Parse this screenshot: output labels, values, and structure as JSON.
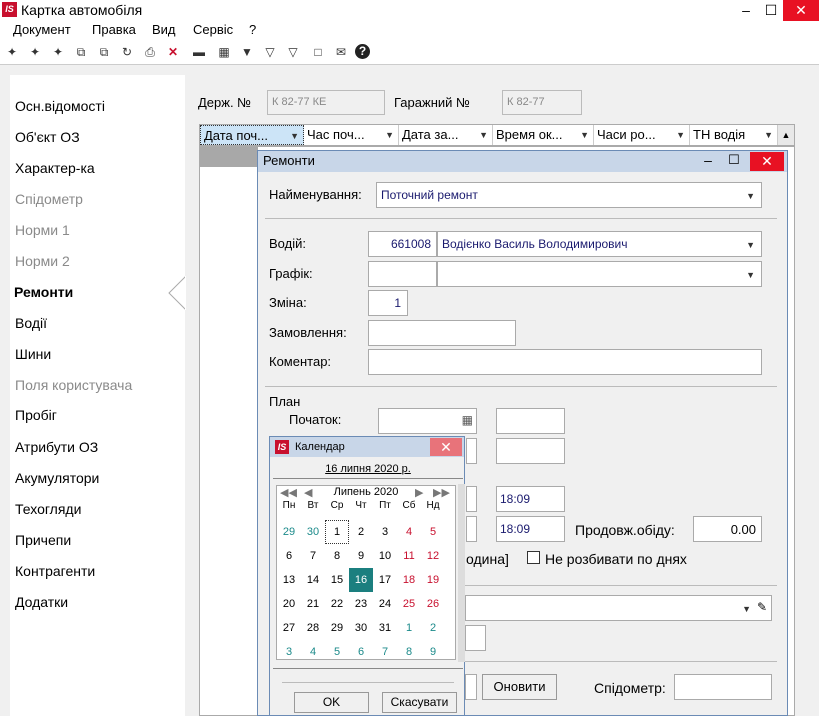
{
  "window": {
    "title": "Картка автомобіля",
    "logo": "IS"
  },
  "menu": [
    "Документ",
    "Правка",
    "Вид",
    "Сервіс",
    "?"
  ],
  "sidebar": [
    "Осн.відомості",
    "Об'єкт ОЗ",
    "Характер-ка",
    "Спідометр",
    "Норми 1",
    "Норми 2",
    "Ремонти",
    "Водії",
    "Шини",
    "Поля користувача",
    "Пробіг",
    "Атрибути ОЗ",
    "Акумулятори",
    "Техогляди",
    "Причепи",
    "Контрагенти",
    "Додатки"
  ],
  "header": {
    "state_no_label": "Держ. №",
    "state_no": "К 82-77 КЕ",
    "garage_no_label": "Гаражний №",
    "garage_no": "К 82-77"
  },
  "grid": {
    "columns": [
      "Дата поч...",
      "Час поч...",
      "Дата за...",
      "Время ок...",
      "Часи ро...",
      "ТН водія"
    ]
  },
  "dialog": {
    "title": "Ремонти",
    "name_label": "Найменування:",
    "name_value": "Поточний ремонт",
    "driver_label": "Водій:",
    "driver_code": "661008",
    "driver_name": "Водієнко Василь Володимирович",
    "schedule_label": "Графік:",
    "shift_label": "Зміна:",
    "shift_value": "1",
    "order_label": "Замовлення:",
    "comment_label": "Коментар:",
    "plan_label": "План",
    "start_label": "Початок:",
    "time1": "18:09",
    "time2": "18:09",
    "lunch_label": "Продовж.обіду:",
    "lunch_value": "0.00",
    "hour_text": "одина]",
    "nosplit_label": "Не розбивати по днях",
    "refresh_label": "Оновити",
    "speedometer_label": "Спідометр:"
  },
  "calendar": {
    "title": "Календар",
    "logo": "IS",
    "today": "16 липня 2020 р.",
    "month": "Липень 2020",
    "weekdays": [
      "Пн",
      "Вт",
      "Ср",
      "Чт",
      "Пт",
      "Сб",
      "Нд"
    ],
    "weeks": [
      [
        "29",
        "30",
        "1",
        "2",
        "3",
        "4",
        "5"
      ],
      [
        "6",
        "7",
        "8",
        "9",
        "10",
        "11",
        "12"
      ],
      [
        "13",
        "14",
        "15",
        "16",
        "17",
        "18",
        "19"
      ],
      [
        "20",
        "21",
        "22",
        "23",
        "24",
        "25",
        "26"
      ],
      [
        "27",
        "28",
        "29",
        "30",
        "31",
        "1",
        "2"
      ],
      [
        "3",
        "4",
        "5",
        "6",
        "7",
        "8",
        "9"
      ]
    ],
    "ok": "OK",
    "cancel": "Скасувати"
  },
  "colors": {
    "accent": "#1b8a8a",
    "weekend": "#c8102e",
    "close": "#e81123"
  }
}
